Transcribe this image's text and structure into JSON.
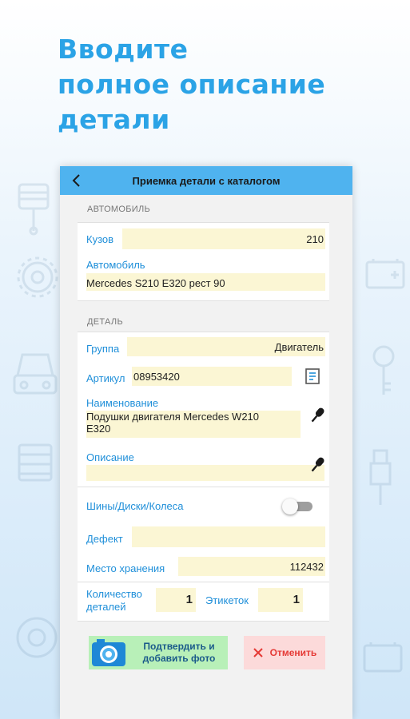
{
  "headline": [
    "Вводите",
    "полное описание",
    "детали"
  ],
  "appbar": {
    "title": "Приемка детали с каталогом"
  },
  "car_section": {
    "caption": "АВТОМОБИЛЬ",
    "body_label": "Кузов",
    "body_value": "210",
    "car_label": "Автомобиль",
    "car_value": "Mercedes S210 E320 рест 90"
  },
  "part_section": {
    "caption": "ДЕТАЛЬ",
    "group_label": "Группа",
    "group_value": "Двигатель",
    "article_label": "Артикул",
    "article_value": "08953420",
    "name_label": "Наименование",
    "name_value_line1": "Подушки двигателя Mercedes W210",
    "name_value_line2": "E320",
    "desc_label": "Описание",
    "desc_value": "",
    "tires_label": "Шины/Диски/Колеса",
    "tires_toggle_on": false,
    "defect_label": "Дефект",
    "defect_value": "",
    "storage_label": "Место хранения",
    "storage_value": "112432",
    "qty_label_line1": "Количество",
    "qty_label_line2": "деталей",
    "qty_value": "1",
    "labels_label": "Этикеток",
    "labels_value": "1"
  },
  "buttons": {
    "confirm_line1": "Подтвердить и",
    "confirm_line2": "добавить фото",
    "cancel": "Отменить"
  },
  "colors": {
    "headline": "#2ba3e6",
    "appbar": "#4fb3ef",
    "label": "#1f8fd9",
    "field_bg": "#fbf6d4",
    "confirm_bg": "#b8f0b8",
    "cancel_bg": "#fcdada",
    "cancel_text": "#e53935"
  },
  "icons": [
    "back-arrow-icon",
    "barcode-scan-icon",
    "microphone-icon",
    "camera-icon",
    "close-icon"
  ]
}
